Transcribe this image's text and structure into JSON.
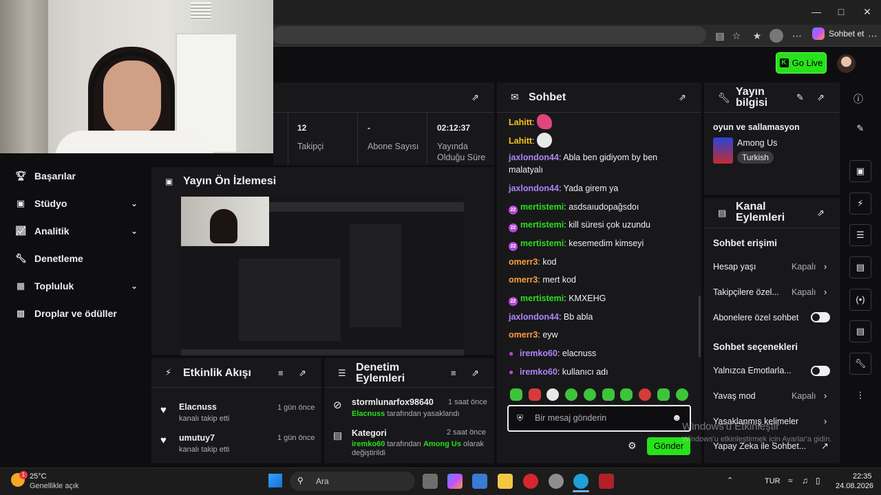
{
  "browser": {
    "copilot_label": "Sohbet et"
  },
  "header": {
    "go_live_label": "Go Live"
  },
  "sidebar": {
    "items": [
      {
        "label": "Başarılar"
      },
      {
        "label": "Stüdyo"
      },
      {
        "label": "Analitik"
      },
      {
        "label": "Denetleme"
      },
      {
        "label": "Topluluk"
      },
      {
        "label": "Droplar ve ödüller"
      }
    ]
  },
  "stats": {
    "followers_value": "12",
    "followers_label": "Takipçi",
    "subs_value": "-",
    "subs_label": "Abone Sayısı",
    "uptime_value": "02:12:37",
    "uptime_label_1": "Yayında",
    "uptime_label_2": "Olduğu Süre"
  },
  "preview": {
    "title": "Yayın Ön İzlemesi"
  },
  "activity": {
    "title": "Etkinlik Akışı",
    "items": [
      {
        "name": "Elacnuss",
        "text": "kanalı takip etti",
        "time": "1 gün önce"
      },
      {
        "name": "umutuy7",
        "text": "kanalı takip etti",
        "time": "1 gün önce"
      }
    ]
  },
  "moderation": {
    "title_1": "Denetim",
    "title_2": "Eylemleri",
    "items": [
      {
        "name": "stormlunarfox98640",
        "time": "1 saat önce",
        "actor": "Elacnuss",
        "text": " tarafından yasaklandı"
      },
      {
        "name": "Kategori",
        "time": "2 saat önce",
        "actor": "iremko60",
        "mid": " tarafından ",
        "target": "Among Us",
        "text": " olarak",
        "text2": "değiştirildi"
      }
    ]
  },
  "chat": {
    "title": "Sohbet",
    "messages": [
      {
        "user": "Lahitt",
        "text": ""
      },
      {
        "user": "Lahitt",
        "text": ""
      },
      {
        "user": "jaxlondon44",
        "text": " Abla ben gidiyom by ben malatyalı"
      },
      {
        "user": "jaxlondon44",
        "text": " Yada girem ya"
      },
      {
        "user": "mertistemi",
        "text": " asdsaıudopağsdoı"
      },
      {
        "user": "mertistemi",
        "text": " kill süresi çok uzundu"
      },
      {
        "user": "mertistemi",
        "text": " kesemedim kimseyi"
      },
      {
        "user": "omerr3",
        "text": " kod"
      },
      {
        "user": "omerr3",
        "text": " mert kod"
      },
      {
        "user": "mertistemi",
        "text": " KMXEHG"
      },
      {
        "user": "jaxlondon44",
        "text": " Bb abla"
      },
      {
        "user": "omerr3",
        "text": " eyw"
      },
      {
        "user": "iremko60",
        "text": " elacnuss"
      },
      {
        "user": "iremko60",
        "text": " kullanıcı adı"
      }
    ],
    "badge_text": "22",
    "input_placeholder": "Bir mesaj gönderin",
    "send_label": "Gönder"
  },
  "stream_info": {
    "title_1": "Yayın",
    "title_2": "bilgisi",
    "stream_title": "oyun ve sallamasyon",
    "category": "Among Us",
    "language": "Turkish"
  },
  "channel_actions": {
    "title_1": "Kanal",
    "title_2": "Eylemleri",
    "chat_access_heading": "Sohbet erişimi",
    "account_age_label": "Hesap yaşı",
    "account_age_value": "Kapalı",
    "followers_only_label": "Takipçilere özel...",
    "followers_only_value": "Kapalı",
    "subs_only_label": "Abonelere özel sohbet",
    "chat_options_heading": "Sohbet seçenekleri",
    "emote_only_label": "Yalnızca Emotlarla...",
    "slow_mode_label": "Yavaş mod",
    "slow_mode_value": "Kapalı",
    "banned_words_label": "Yasaklanmış kelimeler",
    "ai_label": "Yapay Zeka ile Sohbet..."
  },
  "watermark": {
    "line1": "Windows'u Etkinleştir",
    "line2": "Windows'u etkinleştirmek için Ayarlar'a gidin."
  },
  "taskbar": {
    "temp": "25°C",
    "weather": "Genellikle açık",
    "weather_badge": "1",
    "search_label": "Ara",
    "lang": "TUR",
    "time": "22:35",
    "date": "24.08.2026"
  },
  "colors": {
    "accent": "#28e01b",
    "panel": "#18181b",
    "background": "#0e0e10",
    "username_purple": "#b548d6",
    "username_orange": "#ff9d3c",
    "username_green": "#28e01b",
    "username_lavender": "#b084f7",
    "username_yellow": "#f5c518"
  }
}
